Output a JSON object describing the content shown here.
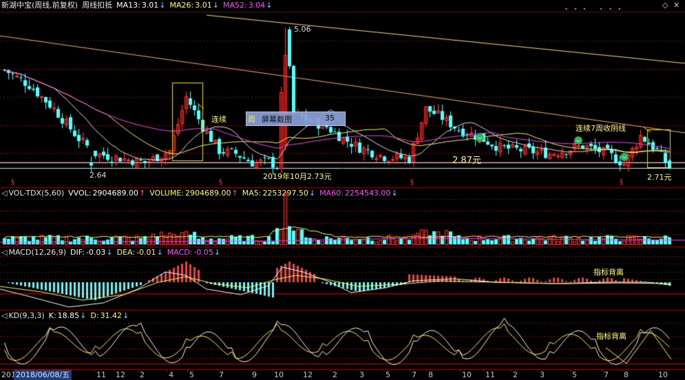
{
  "main_panel": {
    "title": "新湖中宝(周线,前复权)",
    "indicator_name": "周线扣抵",
    "ma13": {
      "label": "MA13:",
      "value": "3.01",
      "arrow": "↓",
      "color": "#ffffff"
    },
    "ma26": {
      "label": "MA26:",
      "value": "3.01",
      "arrow": "↓",
      "color": "#ffff55"
    },
    "ma52": {
      "label": "MA52:",
      "value": "3.04",
      "arrow": "↓",
      "color": "#ff44ff"
    },
    "high_label": "5.06",
    "low_left_label": "2.64",
    "low_oct_label": "2019年10月2.73元",
    "mid_label": "2.87元",
    "right_low_label": "2.71元",
    "annotation_left": "连续",
    "annotation_left_suffix": "周",
    "annotation_right": "连续7周收阴线",
    "screenshot_label": "屏幕截图",
    "screenshot_value": "35",
    "diamond_icons": [
      "◆◆",
      "◆◆",
      "◆◆"
    ]
  },
  "vol_panel": {
    "title": "VOL-TDX(5,60)",
    "vvol": {
      "label": "VVOL:",
      "value": "2904689.00",
      "arrow": "↑"
    },
    "volume": {
      "label": "VOLUME:",
      "value": "2904689.00",
      "arrow": "↑"
    },
    "ma5": {
      "label": "MA5:",
      "value": "2253297.50",
      "arrow": "↓"
    },
    "ma60": {
      "label": "MA60:",
      "value": "2254543.00",
      "arrow": "↓"
    }
  },
  "macd_panel": {
    "title": "MACD(12,26,9)",
    "dif": {
      "label": "DIF:",
      "value": "-0.03",
      "arrow": "↓"
    },
    "dea": {
      "label": "DEA:",
      "value": "-0.01",
      "arrow": "↓"
    },
    "macd": {
      "label": "MACD:",
      "value": "-0.05",
      "arrow": "↓"
    },
    "note": "指标背离"
  },
  "kd_panel": {
    "title": "KD(9,3,3)",
    "k": {
      "label": "K:",
      "value": "18.85",
      "arrow": "↓"
    },
    "d": {
      "label": "D:",
      "value": "31.42",
      "arrow": "↓"
    },
    "note": "指标背离"
  },
  "bottom_axis": {
    "current_date": "2018/06/08/五",
    "left_label": "201",
    "ticks": [
      "11",
      "12",
      "2",
      "4",
      "5",
      "7",
      "9",
      "10",
      "12",
      "2",
      "3",
      "5",
      "7",
      "8",
      "10",
      "11",
      "2",
      "3",
      "5",
      "7",
      "8",
      "10"
    ]
  },
  "colors": {
    "up": "#ff3b3b",
    "down": "#54ffff",
    "grid": "#8b0000",
    "ma13": "#e8e8e8",
    "ma26": "#ffff55",
    "ma52": "#ff44ff",
    "trend": "#ffb060"
  }
}
